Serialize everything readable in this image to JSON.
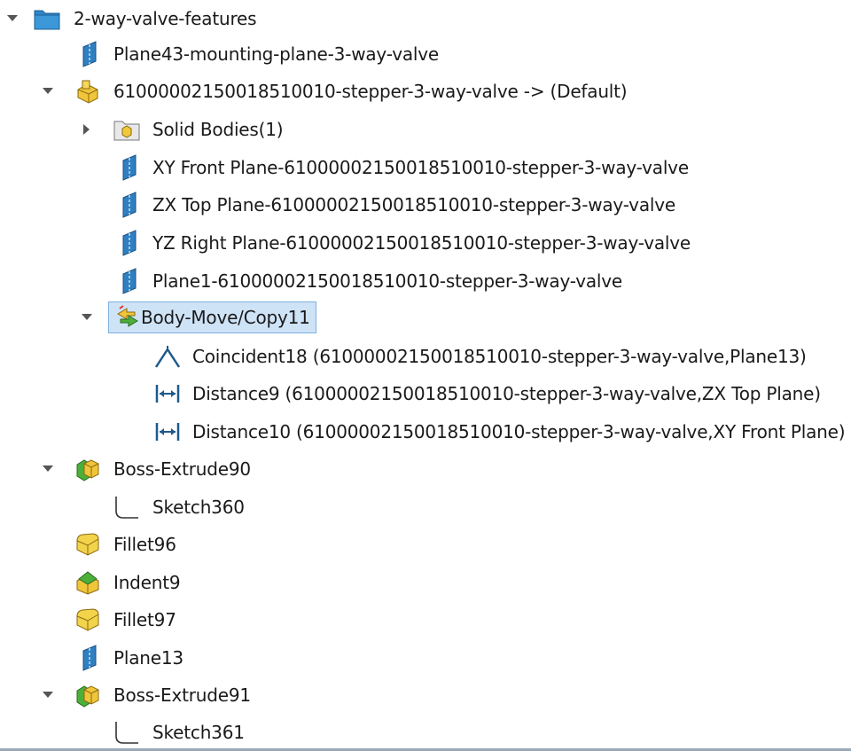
{
  "tree": {
    "root": {
      "label": "2-way-valve-features",
      "icon": "folder-icon",
      "expanded": true
    },
    "items": [
      {
        "label": "Plane43-mounting-plane-3-way-valve",
        "icon": "plane-icon"
      },
      {
        "label": "61000002150018510010-stepper-3-way-valve -> (Default)",
        "icon": "part-icon",
        "expanded": true
      },
      {
        "label": "Solid Bodies(1)",
        "icon": "solid-bodies-folder-icon",
        "expanded": false
      },
      {
        "label": "XY Front Plane-61000002150018510010-stepper-3-way-valve",
        "icon": "plane-icon"
      },
      {
        "label": "ZX Top Plane-61000002150018510010-stepper-3-way-valve",
        "icon": "plane-icon"
      },
      {
        "label": "YZ Right Plane-61000002150018510010-stepper-3-way-valve",
        "icon": "plane-icon"
      },
      {
        "label": "Plane1-61000002150018510010-stepper-3-way-valve",
        "icon": "plane-icon"
      },
      {
        "label": "Body-Move/Copy11",
        "icon": "move-copy-icon",
        "expanded": true,
        "selected": true
      },
      {
        "label": "Coincident18 (61000002150018510010-stepper-3-way-valve,Plane13)",
        "icon": "coincident-icon"
      },
      {
        "label": "Distance9 (61000002150018510010-stepper-3-way-valve,ZX Top Plane)",
        "icon": "distance-icon"
      },
      {
        "label": "Distance10 (61000002150018510010-stepper-3-way-valve,XY Front Plane)",
        "icon": "distance-icon"
      },
      {
        "label": "Boss-Extrude90",
        "icon": "boss-extrude-icon",
        "expanded": true
      },
      {
        "label": "Sketch360",
        "icon": "sketch-icon"
      },
      {
        "label": "Fillet96",
        "icon": "fillet-icon"
      },
      {
        "label": "Indent9",
        "icon": "indent-icon"
      },
      {
        "label": "Fillet97",
        "icon": "fillet-icon"
      },
      {
        "label": "Plane13",
        "icon": "plane-icon"
      },
      {
        "label": "Boss-Extrude91",
        "icon": "boss-extrude-icon",
        "expanded": true
      },
      {
        "label": "Sketch361",
        "icon": "sketch-icon"
      }
    ]
  },
  "colors": {
    "selection_bg": "#cfe3f7",
    "selection_border": "#7eb2e0",
    "plane_blue": "#2f7fc1",
    "feature_yellow": "#f3d34a",
    "feature_green": "#4caf3a"
  }
}
